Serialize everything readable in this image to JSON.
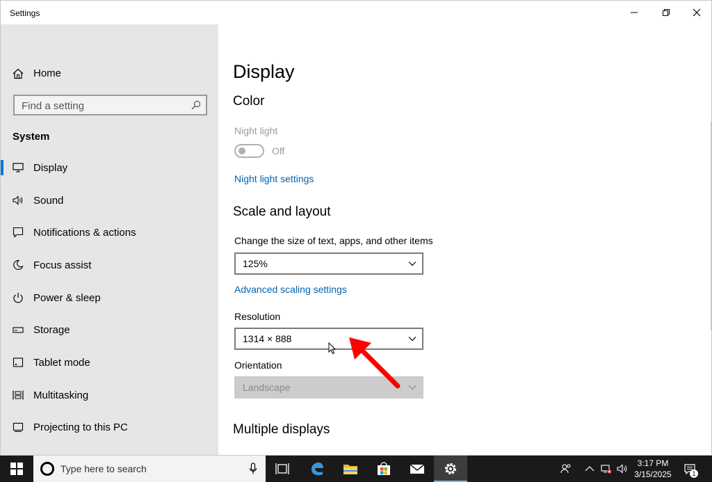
{
  "window": {
    "title": "Settings"
  },
  "sidebar": {
    "home_label": "Home",
    "search_placeholder": "Find a setting",
    "section": "System",
    "items": [
      {
        "label": "Display",
        "icon": "monitor-icon",
        "active": true
      },
      {
        "label": "Sound",
        "icon": "speaker-icon"
      },
      {
        "label": "Notifications & actions",
        "icon": "notification-icon"
      },
      {
        "label": "Focus assist",
        "icon": "moon-icon"
      },
      {
        "label": "Power & sleep",
        "icon": "power-icon"
      },
      {
        "label": "Storage",
        "icon": "storage-icon"
      },
      {
        "label": "Tablet mode",
        "icon": "tablet-icon"
      },
      {
        "label": "Multitasking",
        "icon": "multitasking-icon"
      },
      {
        "label": "Projecting to this PC",
        "icon": "projecting-icon"
      }
    ]
  },
  "main": {
    "page_title": "Display",
    "color": {
      "heading": "Color",
      "night_light_label": "Night light",
      "night_light_state": "Off",
      "night_light_settings_link": "Night light settings"
    },
    "scale": {
      "heading": "Scale and layout",
      "size_label": "Change the size of text, apps, and other items",
      "size_value": "125%",
      "advanced_link": "Advanced scaling settings",
      "resolution_label": "Resolution",
      "resolution_value": "1314 × 888",
      "orientation_label": "Orientation",
      "orientation_value": "Landscape"
    },
    "multiple": {
      "heading": "Multiple displays"
    }
  },
  "taskbar": {
    "search_text": "Type here to search",
    "time": "3:17 PM",
    "date": "3/15/2025",
    "notification_count": "1"
  },
  "colors": {
    "accent": "#0078d7",
    "link": "#0063b1",
    "annotation": "#ff0000"
  }
}
